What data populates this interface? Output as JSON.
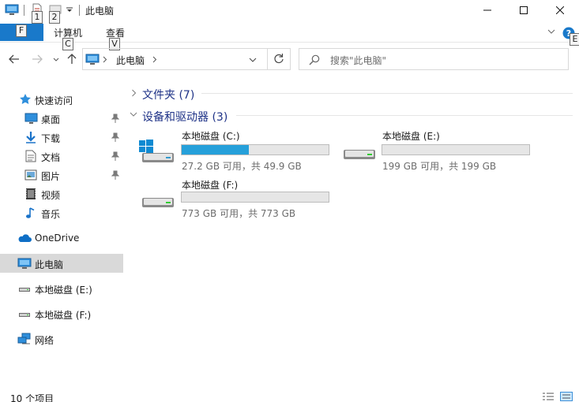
{
  "window": {
    "title": "此电脑",
    "keytips": {
      "qat_1": "1",
      "qat_2": "2",
      "file": "F",
      "computer": "C",
      "view": "V",
      "help": "E"
    }
  },
  "ribbon": {
    "tabs": [
      {
        "label": "计算机"
      },
      {
        "label": "查看"
      }
    ]
  },
  "address": {
    "path": [
      "此电脑"
    ],
    "search_placeholder": "搜索\"此电脑\""
  },
  "sidebar": {
    "quick_access": {
      "label": "快速访问"
    },
    "pinned": [
      {
        "label": "桌面",
        "icon": "desktop-icon",
        "pinned": true
      },
      {
        "label": "下载",
        "icon": "download-icon",
        "pinned": true
      },
      {
        "label": "文档",
        "icon": "document-icon",
        "pinned": true
      },
      {
        "label": "图片",
        "icon": "picture-icon",
        "pinned": true
      },
      {
        "label": "视频",
        "icon": "video-icon",
        "pinned": false
      },
      {
        "label": "音乐",
        "icon": "music-icon",
        "pinned": false
      }
    ],
    "onedrive": {
      "label": "OneDrive"
    },
    "this_pc": {
      "label": "此电脑",
      "selected": true
    },
    "drives": [
      {
        "label": "本地磁盘 (E:)"
      },
      {
        "label": "本地磁盘 (F:)"
      }
    ],
    "network": {
      "label": "网络"
    }
  },
  "content": {
    "groups": [
      {
        "title": "文件夹 (7)",
        "expanded": false
      },
      {
        "title": "设备和驱动器 (3)",
        "expanded": true
      }
    ],
    "drives": [
      {
        "name": "本地磁盘 (C:)",
        "info": "27.2 GB 可用，共 49.9 GB",
        "used_fraction": 0.455,
        "system": true
      },
      {
        "name": "本地磁盘 (E:)",
        "info": "199 GB 可用，共 199 GB",
        "used_fraction": 0.0,
        "system": false
      },
      {
        "name": "本地磁盘 (F:)",
        "info": "773 GB 可用，共 773 GB",
        "used_fraction": 0.0,
        "system": false
      }
    ]
  },
  "status": {
    "item_count": "10 个项目"
  },
  "colors": {
    "accent": "#1979ca",
    "drive_fill": "#26a0da",
    "selection": "#d9d9d9",
    "group_header": "#1e3287"
  }
}
